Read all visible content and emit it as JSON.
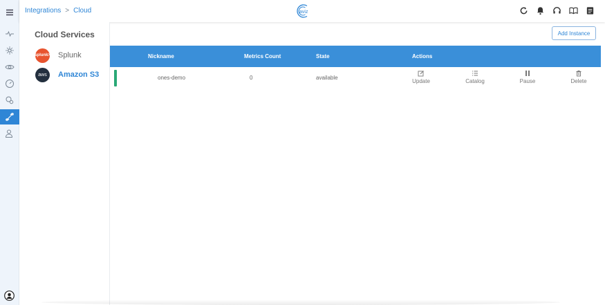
{
  "breadcrumb": {
    "parent": "Integrations",
    "separator": ">",
    "current": "Cloud"
  },
  "logo": {
    "text": "aviz"
  },
  "services": {
    "title": "Cloud Services",
    "items": [
      {
        "name": "Splunk",
        "badge": "splunk>"
      },
      {
        "name": "Amazon S3",
        "badge": "aws",
        "selected": true
      }
    ]
  },
  "toolbar": {
    "add_instance_label": "Add Instance"
  },
  "table": {
    "columns": [
      "Nickname",
      "Metrics Count",
      "State",
      "Actions"
    ],
    "rows": [
      {
        "nickname": "ones-demo",
        "metrics_count": "0",
        "state": "available"
      }
    ],
    "actions": [
      "Update",
      "Catalog",
      "Pause",
      "Delete"
    ]
  },
  "colors": {
    "accent": "#2f86d6",
    "header": "#3a8fd9",
    "status_ok": "#2aa876",
    "splunk": "#e8542f",
    "aws": "#232f3e"
  }
}
